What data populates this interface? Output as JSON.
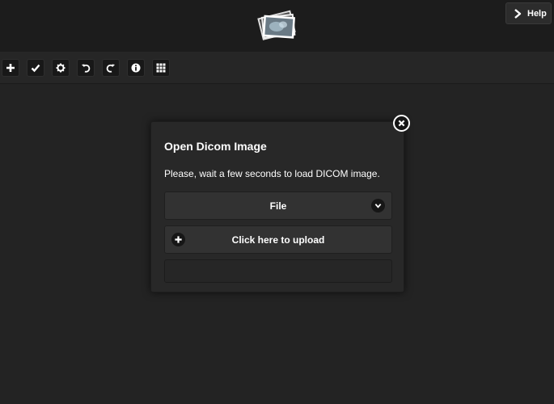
{
  "header": {
    "logo_icon": "dicom-images-logo-icon",
    "help_button": {
      "label": "Help",
      "icon": "chevron-right-icon"
    }
  },
  "toolbar": {
    "items": [
      {
        "icon": "plus-icon"
      },
      {
        "icon": "checkmark-icon"
      },
      {
        "icon": "gear-icon"
      },
      {
        "icon": "undo-icon"
      },
      {
        "icon": "redo-icon"
      },
      {
        "icon": "info-icon"
      },
      {
        "icon": "grid-icon"
      }
    ]
  },
  "modal": {
    "title": "Open Dicom Image",
    "message": "Please, wait a few seconds to load DICOM image.",
    "close_icon": "close-icon",
    "source_select": {
      "selected": "File",
      "icon": "chevron-down-icon"
    },
    "upload_button": {
      "label": "Click here to upload",
      "icon": "plus-icon"
    },
    "progress_text": ""
  },
  "colors": {
    "background": "#232323",
    "header": "#1c1c1c",
    "toolbar": "#262626",
    "modal": "#282828",
    "control": "#323232",
    "text": "#ffffff"
  }
}
